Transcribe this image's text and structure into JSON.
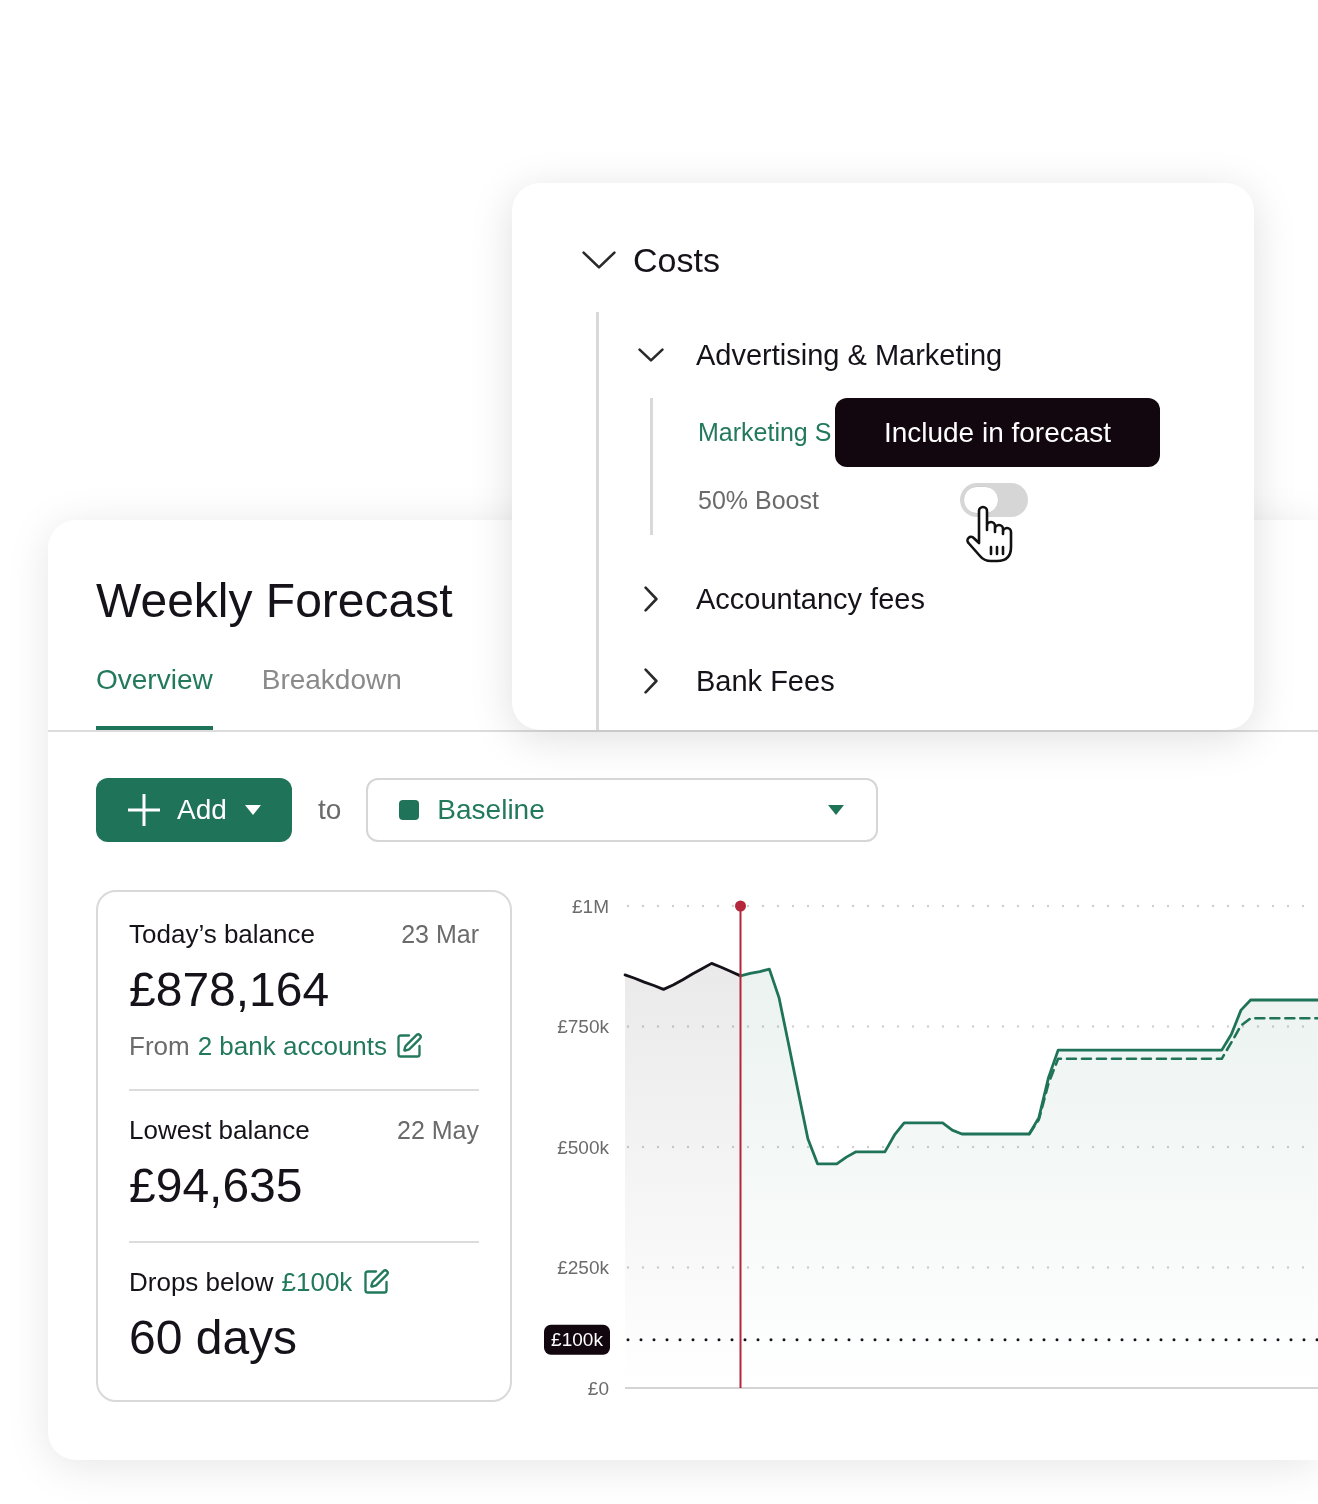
{
  "cost_tree": {
    "label": "Costs",
    "expanded": true,
    "children": [
      {
        "label": "Advertising & Marketing",
        "expanded": true,
        "children": [
          {
            "kind": "link",
            "label": "Marketing S"
          },
          {
            "kind": "toggle",
            "label": "50% Boost",
            "on": false
          }
        ]
      },
      {
        "label": "Accountancy fees",
        "expanded": false
      },
      {
        "label": "Bank Fees",
        "expanded": false
      }
    ]
  },
  "tooltip": {
    "text": "Include in forecast"
  },
  "page_title": "Weekly Forecast",
  "tabs": [
    {
      "label": "Overview",
      "selected": true
    },
    {
      "label": "Breakdown",
      "selected": false
    }
  ],
  "toolbar": {
    "add_button": "Add",
    "connector": "to",
    "scenario_select": "Baseline"
  },
  "summary": [
    {
      "label": "Today’s balance",
      "date": "23 Mar",
      "value": "£878,164",
      "note": {
        "prefix": "From",
        "link": "2 bank accounts"
      }
    },
    {
      "label": "Lowest balance",
      "date": "22 May",
      "value": "£94,635"
    },
    {
      "label": "Drops below",
      "link": "£100k",
      "value": "60 days"
    }
  ],
  "chart": {
    "chart_data": {
      "type": "area",
      "grid": true,
      "categories": [
        null,
        null,
        null,
        null,
        null,
        null,
        null,
        null,
        null,
        null,
        null,
        null,
        null,
        null,
        null,
        null,
        null,
        null,
        null,
        null,
        null,
        null,
        null,
        null,
        null,
        null,
        null,
        null,
        null,
        null,
        null,
        null,
        null,
        null,
        null,
        null,
        null,
        null,
        null,
        null,
        null,
        null,
        null,
        null,
        null,
        null,
        null,
        null,
        null,
        null,
        null,
        null,
        null,
        null,
        null,
        null,
        null,
        null,
        null,
        null,
        null,
        null,
        null,
        null,
        null,
        null,
        null,
        null,
        null,
        null,
        null,
        null,
        null
      ],
      "ylim": [
        0,
        1000000
      ],
      "yticks": [
        {
          "value": 0,
          "label": "£0"
        },
        {
          "value": 250000,
          "label": "£250k"
        },
        {
          "value": 500000,
          "label": "£500k"
        },
        {
          "value": 750000,
          "label": "£750k"
        },
        {
          "value": 1000000,
          "label": "£1M"
        }
      ],
      "series": [
        {
          "color": "#16121a",
          "values": [
            857000,
            850000,
            842000,
            835000,
            827000,
            836000,
            847000,
            859000,
            870000,
            881000,
            873000,
            864000,
            855000,
            null,
            null,
            null,
            null,
            null,
            null,
            null,
            null,
            null,
            null,
            null,
            null,
            null,
            null,
            null,
            null,
            null,
            null,
            null,
            null,
            null,
            null,
            null,
            null,
            null,
            null,
            null,
            null,
            null,
            null,
            null,
            null,
            null,
            null,
            null,
            null,
            null,
            null,
            null,
            null,
            null,
            null,
            null,
            null,
            null,
            null,
            null,
            null,
            null,
            null,
            null,
            null,
            null,
            null,
            null,
            null,
            null,
            null,
            null,
            null
          ]
        },
        {
          "color": "#1f7358",
          "values": [
            null,
            null,
            null,
            null,
            null,
            null,
            null,
            null,
            null,
            null,
            null,
            null,
            855000,
            860000,
            864000,
            869000,
            810000,
            713000,
            614000,
            517000,
            465000,
            465000,
            465000,
            479000,
            490000,
            490000,
            490000,
            490000,
            525000,
            550000,
            550000,
            550000,
            550000,
            550000,
            535000,
            527000,
            527000,
            527000,
            527000,
            527000,
            527000,
            527000,
            527000,
            561000,
            644000,
            701000,
            701000,
            701000,
            701000,
            701000,
            701000,
            701000,
            701000,
            701000,
            701000,
            701000,
            701000,
            701000,
            701000,
            701000,
            701000,
            701000,
            701000,
            734000,
            784000,
            805000,
            805000,
            805000,
            805000,
            805000,
            805000,
            805000,
            805000
          ]
        },
        {
          "color": "#1f7358",
          "type": "line",
          "line_style": "dashed",
          "values": [
            null,
            null,
            null,
            null,
            null,
            null,
            null,
            null,
            null,
            null,
            null,
            null,
            null,
            null,
            null,
            null,
            null,
            null,
            null,
            null,
            null,
            null,
            null,
            null,
            null,
            null,
            null,
            null,
            null,
            null,
            null,
            null,
            null,
            null,
            null,
            null,
            null,
            null,
            null,
            null,
            null,
            null,
            527000,
            557000,
            632000,
            683000,
            683000,
            683000,
            683000,
            683000,
            683000,
            683000,
            683000,
            683000,
            683000,
            683000,
            683000,
            683000,
            683000,
            683000,
            683000,
            683000,
            683000,
            717000,
            752000,
            767000,
            767000,
            767000,
            767000,
            767000,
            767000,
            767000,
            767000
          ]
        }
      ],
      "ref_lines": [
        {
          "axis": "y",
          "value": 100000,
          "label": "£100k"
        }
      ]
    }
  }
}
